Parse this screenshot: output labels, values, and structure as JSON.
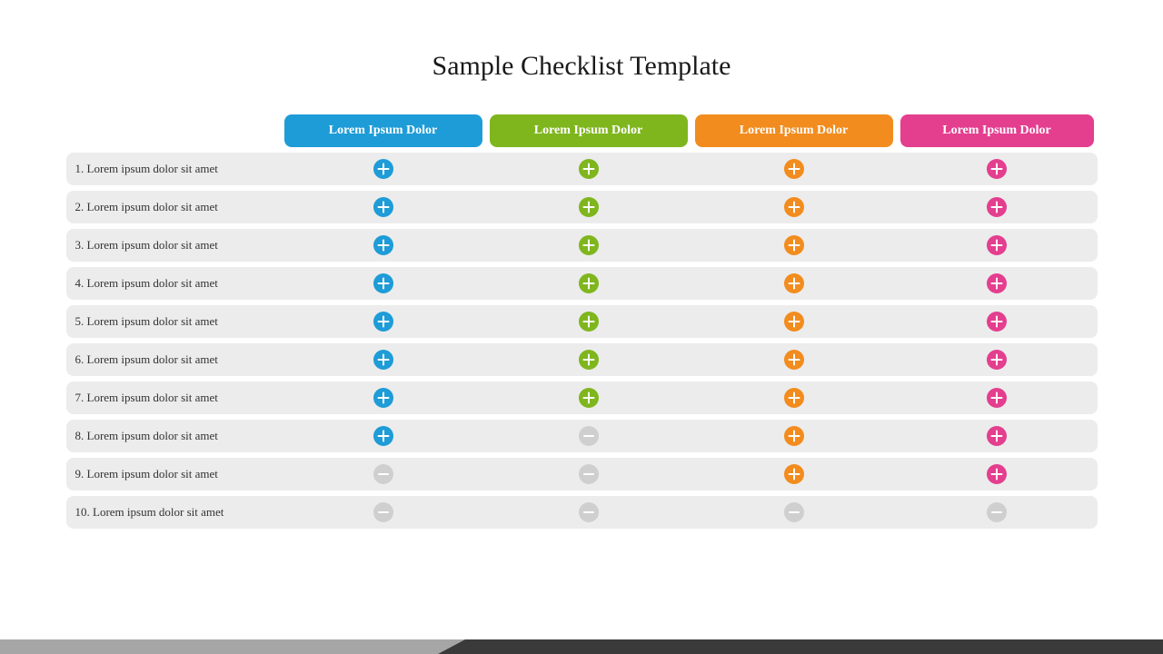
{
  "title": "Sample Checklist Template",
  "columns": [
    {
      "label": "Lorem Ipsum Dolor",
      "color": "#1e9cd7"
    },
    {
      "label": "Lorem Ipsum Dolor",
      "color": "#7fb61e"
    },
    {
      "label": "Lorem Ipsum Dolor",
      "color": "#f28c1e"
    },
    {
      "label": "Lorem Ipsum Dolor",
      "color": "#e43e8f"
    }
  ],
  "rows": [
    {
      "label": "1. Lorem ipsum dolor sit amet",
      "cells": [
        "plus",
        "plus",
        "plus",
        "plus"
      ]
    },
    {
      "label": "2. Lorem ipsum dolor sit amet",
      "cells": [
        "plus",
        "plus",
        "plus",
        "plus"
      ]
    },
    {
      "label": "3. Lorem ipsum dolor sit amet",
      "cells": [
        "plus",
        "plus",
        "plus",
        "plus"
      ]
    },
    {
      "label": "4. Lorem ipsum dolor sit amet",
      "cells": [
        "plus",
        "plus",
        "plus",
        "plus"
      ]
    },
    {
      "label": "5. Lorem ipsum dolor sit amet",
      "cells": [
        "plus",
        "plus",
        "plus",
        "plus"
      ]
    },
    {
      "label": "6. Lorem ipsum dolor sit amet",
      "cells": [
        "plus",
        "plus",
        "plus",
        "plus"
      ]
    },
    {
      "label": "7. Lorem ipsum dolor sit amet",
      "cells": [
        "plus",
        "plus",
        "plus",
        "plus"
      ]
    },
    {
      "label": "8. Lorem ipsum dolor sit amet",
      "cells": [
        "plus",
        "minus",
        "plus",
        "plus"
      ]
    },
    {
      "label": "9. Lorem ipsum dolor sit amet",
      "cells": [
        "minus",
        "minus",
        "plus",
        "plus"
      ]
    },
    {
      "label": "10. Lorem ipsum dolor sit amet",
      "cells": [
        "minus",
        "minus",
        "minus",
        "minus"
      ]
    }
  ],
  "minus_color": "#cfcfcf"
}
